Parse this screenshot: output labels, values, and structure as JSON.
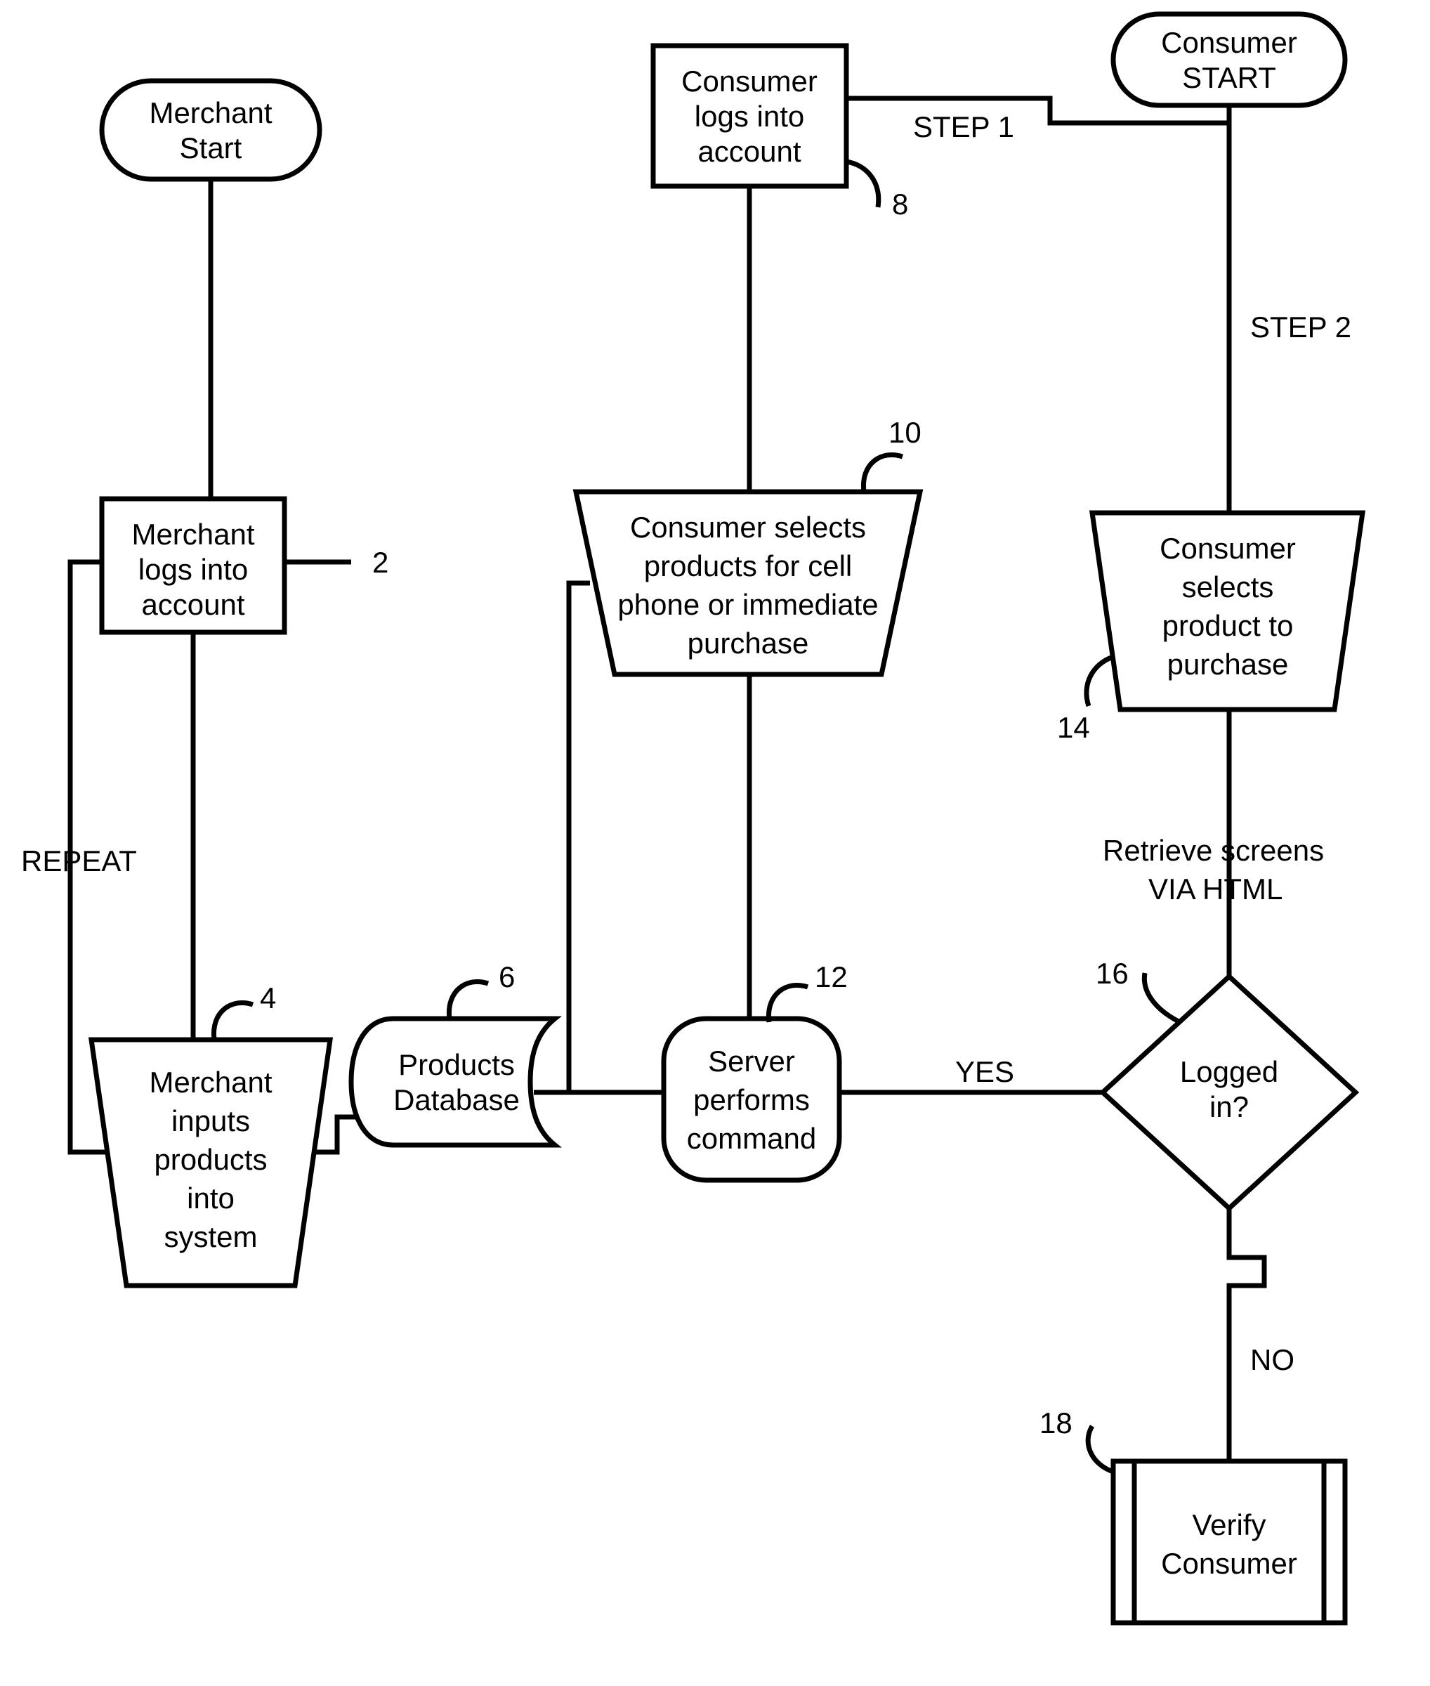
{
  "nodes": {
    "merchant_start": [
      "Merchant",
      "Start"
    ],
    "merchant_login": [
      "Merchant",
      "logs into",
      "account"
    ],
    "merchant_input": [
      "Merchant",
      "inputs",
      "products",
      "into",
      "system"
    ],
    "products_db": [
      "Products",
      "Database"
    ],
    "consumer_login": [
      "Consumer",
      "logs into",
      "account"
    ],
    "consumer_selects": [
      "Consumer selects",
      "products for cell",
      "phone or immediate",
      "purchase"
    ],
    "server_cmd": [
      "Server",
      "performs",
      "command"
    ],
    "consumer_start": [
      "Consumer",
      "START"
    ],
    "consumer_selects2": [
      "Consumer",
      "selects",
      "product to",
      "purchase"
    ],
    "logged_in": [
      "Logged",
      "in?"
    ],
    "verify": [
      "Verify",
      "Consumer"
    ]
  },
  "edge_labels": {
    "repeat": "REPEAT",
    "step1": "STEP 1",
    "step2": "STEP 2",
    "retrieve": [
      "Retrieve screens",
      "VIA HTML"
    ],
    "yes": "YES",
    "no": "NO"
  },
  "refs": {
    "r2": "2",
    "r4": "4",
    "r6": "6",
    "r8": "8",
    "r10": "10",
    "r12": "12",
    "r14": "14",
    "r16": "16",
    "r18": "18"
  }
}
